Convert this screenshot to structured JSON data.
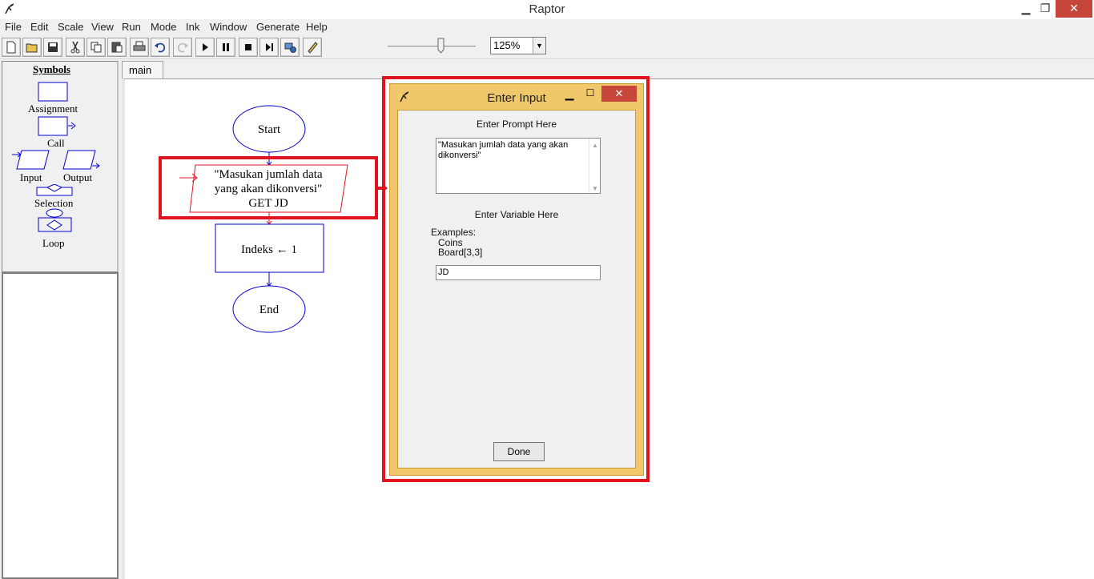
{
  "window": {
    "title": "Raptor"
  },
  "menu": [
    "File",
    "Edit",
    "Scale",
    "View",
    "Run",
    "Mode",
    "Ink",
    "Window",
    "Generate",
    "Help"
  ],
  "toolbar": {
    "buttons": [
      "new-icon",
      "open-icon",
      "save-icon",
      "cut-icon",
      "copy-icon",
      "paste-icon",
      "print-icon",
      "undo-icon",
      "redo-icon",
      "play-icon",
      "pause-icon",
      "stop-icon",
      "step-icon",
      "test-server-icon",
      "ink-pen-icon"
    ],
    "zoom": "125%",
    "speed_level": 0.6
  },
  "symbols": {
    "title": "Symbols",
    "assignment": "Assignment",
    "call": "Call",
    "input": "Input",
    "output": "Output",
    "selection": "Selection",
    "loop": "Loop"
  },
  "tabs": [
    "main"
  ],
  "flowchart": {
    "start": "Start",
    "input_line1": "\"Masukan jumlah data",
    "input_line2": "yang akan dikonversi\"",
    "input_line3": "GET JD",
    "assign": "Indeks ← 1",
    "end": "End"
  },
  "dialog": {
    "title": "Enter Input",
    "prompt_label": "Enter Prompt Here",
    "prompt_value": "\"Masukan jumlah data yang akan dikonversi\"",
    "variable_label": "Enter Variable Here",
    "examples_label": "Examples:",
    "example1": "Coins",
    "example2": "Board[3,3]",
    "variable_value": "JD",
    "done": "Done"
  },
  "colors": {
    "highlight": "#e0141e",
    "flow_blue": "#0000cc",
    "flow_red": "#e0141e",
    "dialog_frame": "#f0c76a"
  }
}
